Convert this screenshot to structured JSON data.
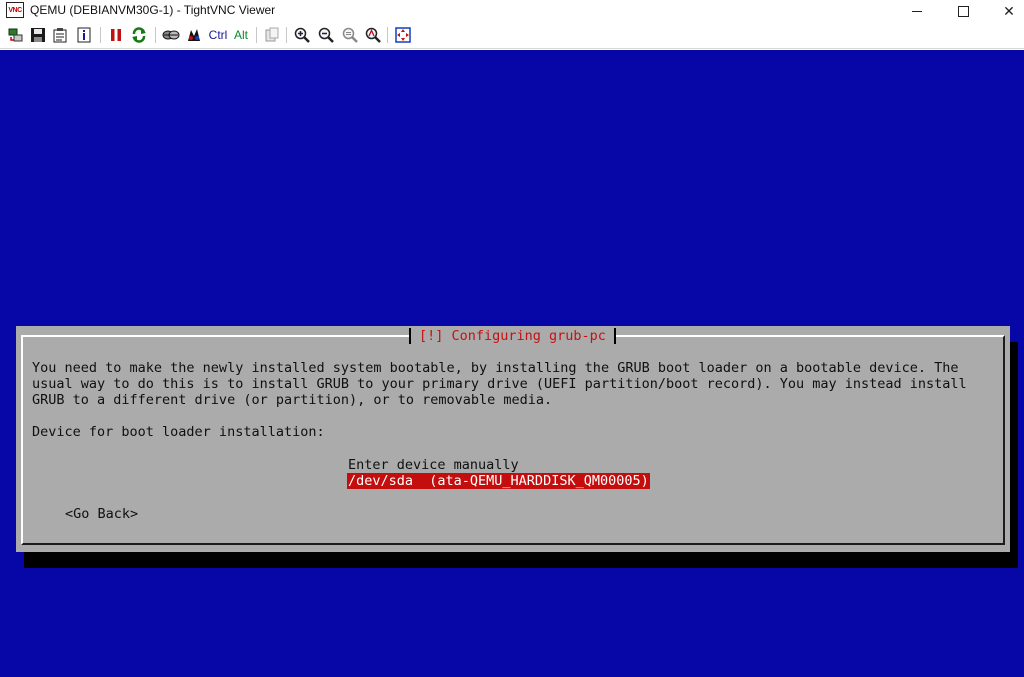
{
  "window": {
    "app_icon_text": "VNC",
    "title": "QEMU (DEBIANVM30G-1) - TightVNC Viewer",
    "controls": {
      "minimize": "minimize-icon",
      "maximize": "maximize-icon",
      "close": "✕"
    }
  },
  "toolbar": {
    "ctrl_label": "Ctrl",
    "alt_label": "Alt",
    "buttons": [
      "new-connection-icon",
      "save-icon",
      "options-icon",
      "connection-info-icon",
      "pause-icon",
      "refresh-icon",
      "transfer-files-icon",
      "send-ctrl-alt-del-icon",
      "ctrl-key-toggle",
      "alt-key-toggle",
      "clipboard-icon",
      "zoom-in-icon",
      "zoom-out-icon",
      "zoom-100-icon",
      "zoom-auto-icon",
      "fullscreen-icon"
    ]
  },
  "dialog": {
    "title": "[!] Configuring grub-pc",
    "paragraph_lines": [
      "You need to make the newly installed system bootable, by installing the GRUB boot loader on a bootable device. The",
      "usual way to do this is to install GRUB to your primary drive (UEFI partition/boot record). You may instead install",
      "GRUB to a different drive (or partition), or to removable media."
    ],
    "prompt": "Device for boot loader installation:",
    "options": [
      "Enter device manually",
      "/dev/sda  (ata-QEMU_HARDDISK_QM00005)"
    ],
    "selected_option_index": 1,
    "go_back_label": "<Go Back>"
  },
  "colors": {
    "screen_background": "#0707a8",
    "dialog_background": "#ababab",
    "title_text": "#c21212",
    "selection_highlight": "#c40d0d"
  }
}
